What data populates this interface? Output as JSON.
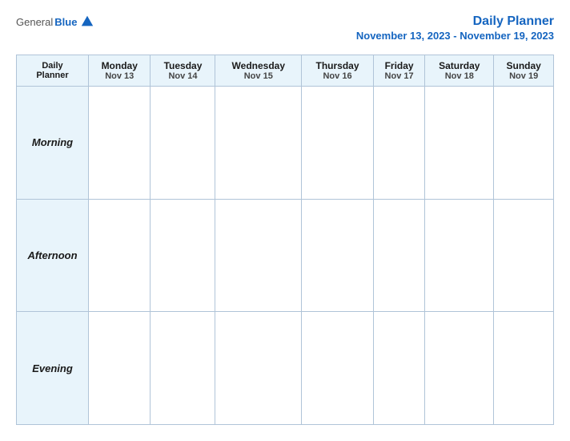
{
  "header": {
    "logo_general": "General",
    "logo_blue": "Blue",
    "title": "Daily Planner",
    "date_range": "November 13, 2023 - November 19, 2023"
  },
  "table": {
    "label_header_top": "Daily",
    "label_header_bottom": "Planner",
    "columns": [
      {
        "day": "Monday",
        "date": "Nov 13"
      },
      {
        "day": "Tuesday",
        "date": "Nov 14"
      },
      {
        "day": "Wednesday",
        "date": "Nov 15"
      },
      {
        "day": "Thursday",
        "date": "Nov 16"
      },
      {
        "day": "Friday",
        "date": "Nov 17"
      },
      {
        "day": "Saturday",
        "date": "Nov 18"
      },
      {
        "day": "Sunday",
        "date": "Nov 19"
      }
    ],
    "rows": [
      {
        "label": "Morning"
      },
      {
        "label": "Afternoon"
      },
      {
        "label": "Evening"
      }
    ]
  }
}
